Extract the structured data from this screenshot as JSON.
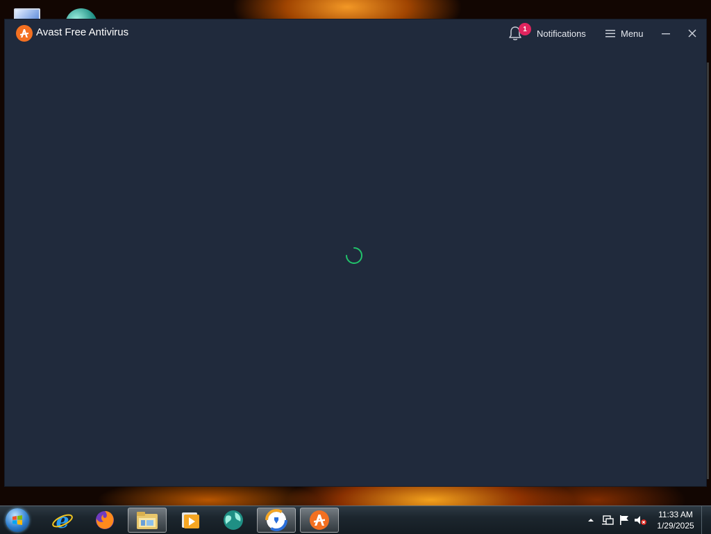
{
  "app": {
    "title": "Avast Free Antivirus",
    "notifications_label": "Notifications",
    "notifications_count": "1",
    "menu_label": "Menu",
    "state": "loading"
  },
  "colors": {
    "window_bg": "#202a3c",
    "accent_orange": "#f37021",
    "badge_red": "#e0245e",
    "spinner_green": "#21c36b"
  },
  "taskbar": {
    "items": [
      {
        "name": "start-button",
        "icon": "windows-orb-icon"
      },
      {
        "name": "internet-explorer",
        "icon": "internet-explorer-icon"
      },
      {
        "name": "firefox",
        "icon": "firefox-icon"
      },
      {
        "name": "file-explorer",
        "icon": "folder-icon"
      },
      {
        "name": "media-player",
        "icon": "media-player-icon"
      },
      {
        "name": "globe-app",
        "icon": "globe-icon"
      },
      {
        "name": "avast-secure-browser",
        "icon": "avast-browser-icon"
      },
      {
        "name": "avast-antivirus",
        "icon": "avast-icon",
        "active": true
      }
    ],
    "clock": {
      "time": "11:33 AM",
      "date": "1/29/2025"
    },
    "tray_icons": [
      "show-hidden-icons-arrow-icon",
      "network-icon",
      "action-center-flag-icon",
      "volume-muted-icon"
    ]
  }
}
